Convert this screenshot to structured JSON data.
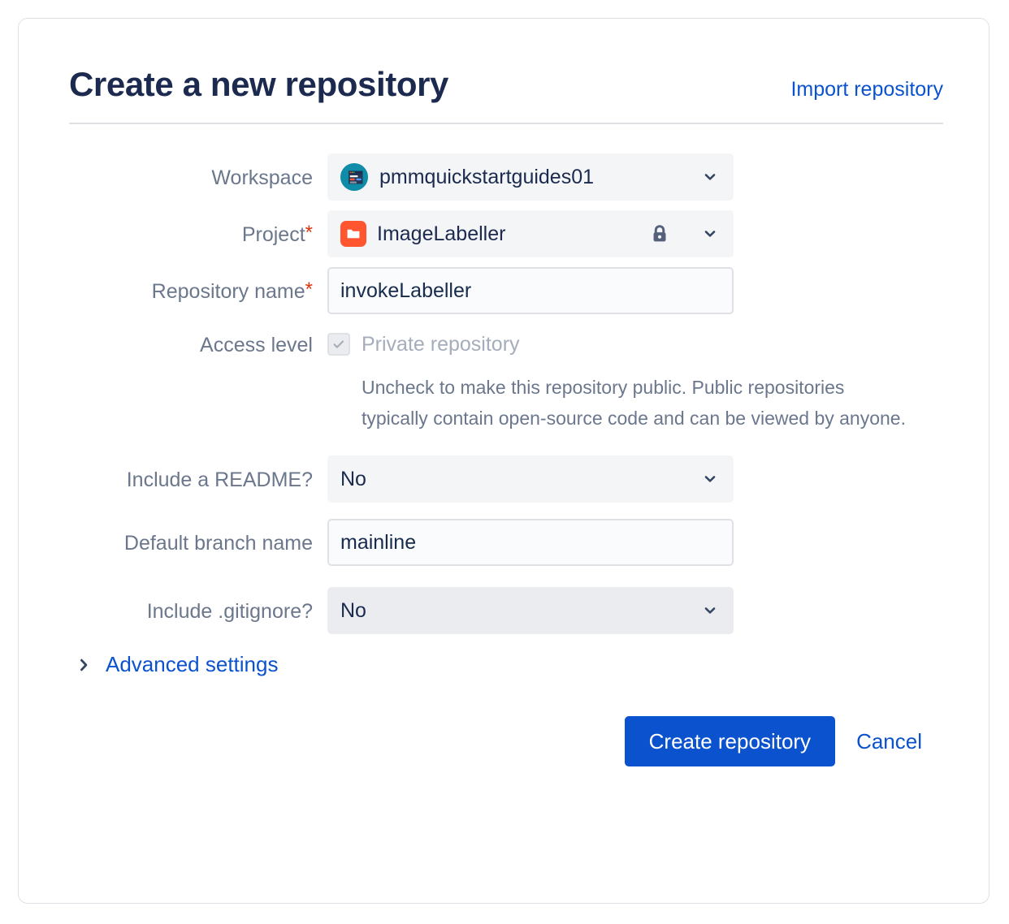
{
  "card": {
    "title": "Create a new repository",
    "import_link": "Import repository"
  },
  "form": {
    "workspace": {
      "label": "Workspace",
      "value": "pmmquickstartguides01",
      "icon": "workspace-avatar-icon",
      "chevron": "chevron-down-icon"
    },
    "project": {
      "label": "Project",
      "required_marker": "*",
      "value": "ImageLabeller",
      "icon": "folder-icon",
      "lock_icon": "lock-icon",
      "chevron": "chevron-down-icon"
    },
    "repository_name": {
      "label": "Repository name",
      "required_marker": "*",
      "value": "invokeLabeller",
      "placeholder": ""
    },
    "access_level": {
      "label": "Access level",
      "checkbox_label": "Private repository",
      "checked": true,
      "check_icon": "checkmark-icon",
      "help_text": "Uncheck to make this repository public. Public repositories typically contain open-source code and can be viewed by anyone."
    },
    "include_readme": {
      "label": "Include a README?",
      "value": "No",
      "chevron": "chevron-down-icon"
    },
    "default_branch": {
      "label": "Default branch name",
      "value": "mainline",
      "placeholder": ""
    },
    "include_gitignore": {
      "label": "Include .gitignore?",
      "value": "No",
      "chevron": "chevron-down-icon"
    },
    "advanced_settings": {
      "label": "Advanced settings",
      "chevron": "chevron-right-icon",
      "expanded": false
    }
  },
  "footer": {
    "submit_label": "Create repository",
    "cancel_label": "Cancel"
  },
  "colors": {
    "accent_blue": "#0B52CE",
    "required_red": "#DE350B",
    "project_icon_red": "#FF5630",
    "workspace_avatar_teal": "#0E8CA8",
    "label_gray": "#6B778C",
    "title_navy": "#1B2A4E",
    "disabled_gray": "#A5ADBA",
    "border_gray": "#DFE1E6"
  }
}
